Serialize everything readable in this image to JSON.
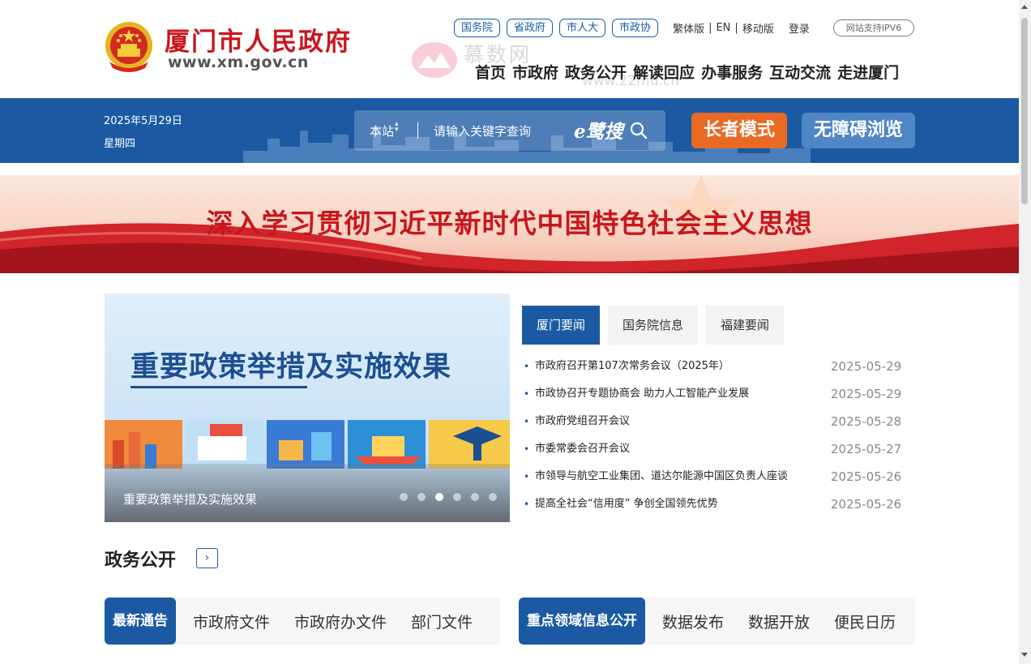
{
  "header": {
    "site_name": "厦门市人民政府",
    "site_url": "www.xm.gov.cn",
    "top_links": [
      "国务院",
      "省政府",
      "市人大",
      "市政协"
    ],
    "text_links": [
      "繁体版",
      "EN",
      "移动版",
      "登录"
    ],
    "ipv6": "网站支持IPV6",
    "nav": [
      "首页",
      "市政府",
      "政务公开",
      "解读回应",
      "办事服务",
      "互动交流",
      "走进厦门"
    ],
    "watermark_cn": "慕数网",
    "watermark_url": "www.22mu.cn"
  },
  "band": {
    "date": "2025年5月29日",
    "weekday": "星期四",
    "search_scope": "本站",
    "search_placeholder": "请输入关键字查询",
    "search_brand": "e鹭搜",
    "elder_mode": "长者模式",
    "accessible": "无障碍浏览"
  },
  "banner": {
    "text": "深入学习贯彻习近平新时代中国特色社会主义思想"
  },
  "carousel": {
    "headline": "重要政策举措及实施效果",
    "caption": "重要政策举措及实施效果",
    "slide_count": 6,
    "active_slide": 3
  },
  "news": {
    "tabs": [
      "厦门要闻",
      "国务院信息",
      "福建要闻"
    ],
    "items": [
      {
        "title": "市政府召开第107次常务会议（2025年）",
        "date": "2025-05-29"
      },
      {
        "title": "市政协召开专题协商会 助力人工智能产业发展",
        "date": "2025-05-29"
      },
      {
        "title": "市政府党组召开会议",
        "date": "2025-05-28"
      },
      {
        "title": "市委常委会召开会议",
        "date": "2025-05-27"
      },
      {
        "title": "市领导与航空工业集团、道达尔能源中国区负责人座谈",
        "date": "2025-05-26"
      },
      {
        "title": "提高全社会“信用度” 争创全国领先优势",
        "date": "2025-05-26"
      }
    ]
  },
  "section": {
    "title": "政务公开",
    "more": "›",
    "tabs_left": [
      "最新通告",
      "市政府文件",
      "市政府办文件",
      "部门文件"
    ],
    "tabs_right": [
      "重点领域信息公开",
      "数据发布",
      "数据开放",
      "便民日历"
    ]
  },
  "colors": {
    "primary": "#1b5aa3",
    "accent_red": "#c8161d",
    "elder_orange": "#ea6a24"
  }
}
